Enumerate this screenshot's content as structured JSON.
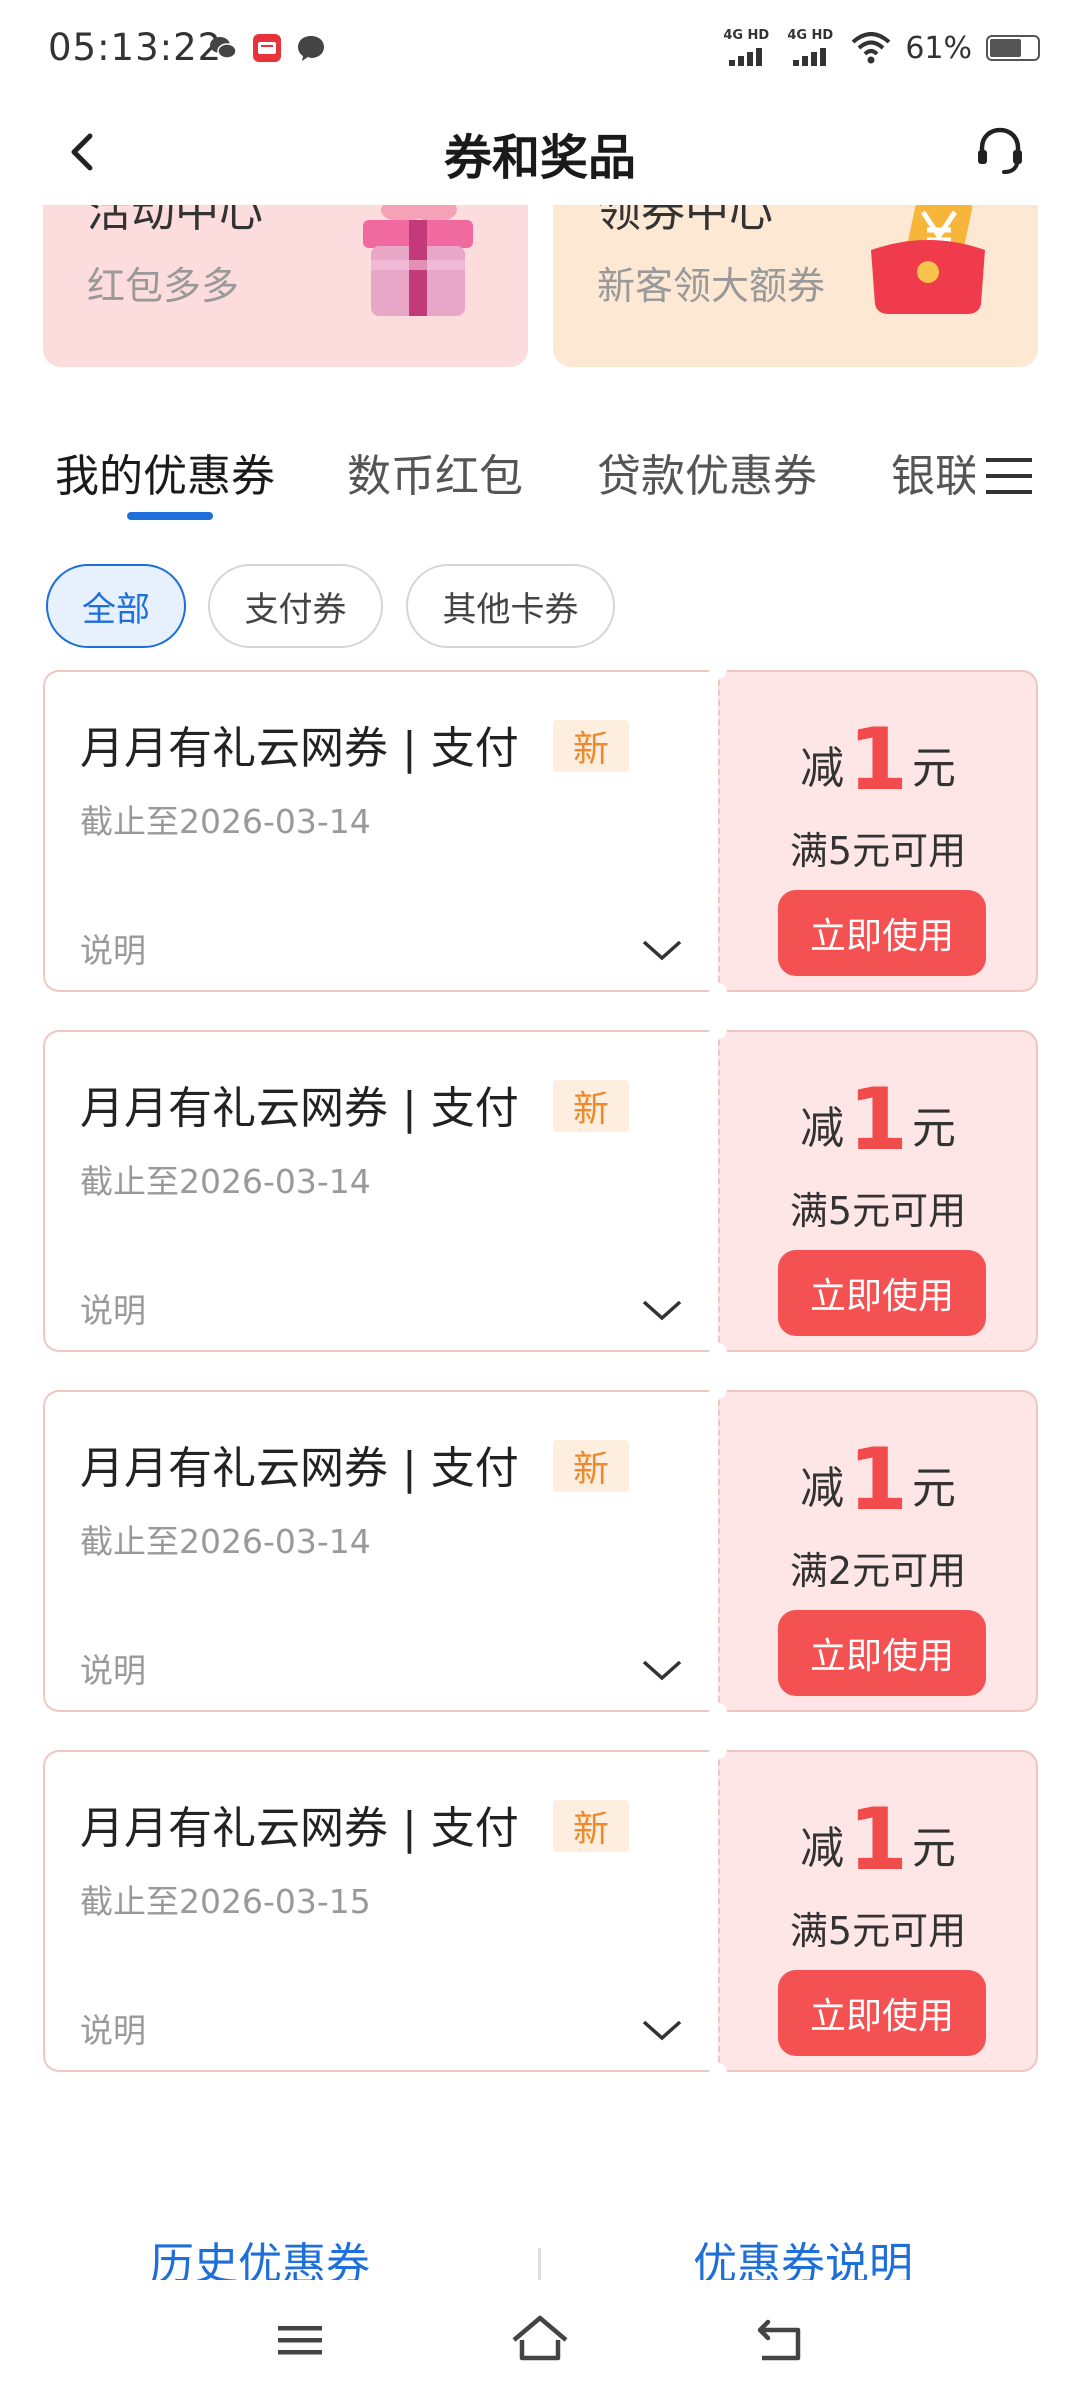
{
  "status_bar": {
    "time": "05:13:22",
    "network1_label": "4G HD",
    "network2_label": "4G HD",
    "battery_percent": "61%",
    "battery_level": 0.61
  },
  "header": {
    "title": "券和奖品"
  },
  "promo_cards": [
    {
      "title": "活动中心",
      "subtitle": "红包多多"
    },
    {
      "title": "领券中心",
      "subtitle": "新客领大额券"
    }
  ],
  "tabs": [
    {
      "label": "我的优惠券",
      "active": true
    },
    {
      "label": "数币红包"
    },
    {
      "label": "贷款优惠券"
    },
    {
      "label": "银联"
    }
  ],
  "filters": [
    {
      "label": "全部",
      "active": true
    },
    {
      "label": "支付券"
    },
    {
      "label": "其他卡券"
    }
  ],
  "coupons": [
    {
      "title": "月月有礼云网券 | 支付",
      "badge": "新",
      "expiry": "截止至2026-03-14",
      "desc_label": "说明",
      "amount_prefix": "减",
      "amount": "1",
      "amount_unit": "元",
      "condition": "满5元可用",
      "button": "立即使用"
    },
    {
      "title": "月月有礼云网券 | 支付",
      "badge": "新",
      "expiry": "截止至2026-03-14",
      "desc_label": "说明",
      "amount_prefix": "减",
      "amount": "1",
      "amount_unit": "元",
      "condition": "满5元可用",
      "button": "立即使用"
    },
    {
      "title": "月月有礼云网券 | 支付",
      "badge": "新",
      "expiry": "截止至2026-03-14",
      "desc_label": "说明",
      "amount_prefix": "减",
      "amount": "1",
      "amount_unit": "元",
      "condition": "满2元可用",
      "button": "立即使用"
    },
    {
      "title": "月月有礼云网券 | 支付",
      "badge": "新",
      "expiry": "截止至2026-03-15",
      "desc_label": "说明",
      "amount_prefix": "减",
      "amount": "1",
      "amount_unit": "元",
      "condition": "满5元可用",
      "button": "立即使用"
    }
  ],
  "bottom_links": {
    "history": "历史优惠券",
    "explain": "优惠券说明"
  },
  "colors": {
    "accent_blue": "#1e6fd9",
    "coupon_red": "#f24b4b",
    "badge_orange": "#ef8a2a"
  }
}
